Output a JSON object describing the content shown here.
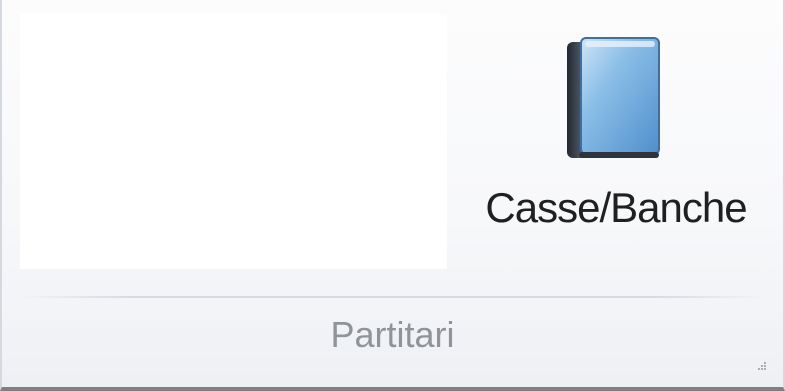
{
  "group": {
    "caption": "Partitari"
  },
  "buttons": [
    {
      "label": "Casse/Banche",
      "icon": "book-icon"
    }
  ],
  "colors": {
    "book_cover": "#7fb4e0",
    "book_spine": "#39414d",
    "caption_text": "#8f949b",
    "label_text": "#202020"
  }
}
